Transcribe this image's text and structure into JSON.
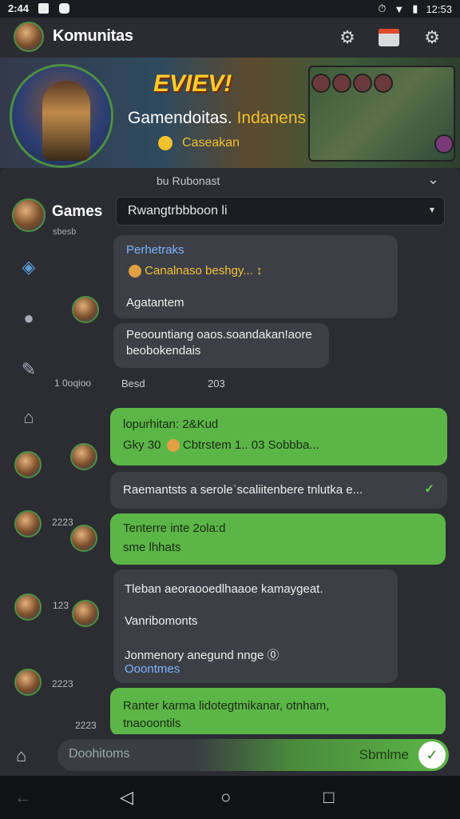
{
  "status_bar": {
    "time": "2:44",
    "battery": "12:53"
  },
  "header": {
    "title": "Komunitas"
  },
  "banner": {
    "logo_text": "EVIEV!",
    "title_white": "Gamendoitas.",
    "title_yellow": "Indanens",
    "subtitle": "Caseakan"
  },
  "panel": {
    "header_text": "bu Rubonast",
    "group_label": "Games",
    "group_sub": "sbesb",
    "dropdown_value": "Rwangtrbbboon li"
  },
  "messages": [
    {
      "style": "gray",
      "lines": [
        "Perhetraks",
        "Canalnaso beshgy... ↕",
        "Agatantem"
      ]
    },
    {
      "style": "gray",
      "lines": [
        "Peoountiang oaos.soandakan!aore",
        "beobokendais"
      ]
    },
    {
      "style": "meta",
      "lines": [
        "Besd",
        "203"
      ]
    },
    {
      "style": "green",
      "lines": [
        "lopurhitan: 2&Kud",
        "Gky 30",
        "Cbtrstem",
        "1..",
        "03 Sobbba..."
      ]
    },
    {
      "style": "gray",
      "lines": [
        "Raemantsts a seroleˈscaliitenbere tnlutka   e..."
      ]
    },
    {
      "style": "green",
      "lines": [
        "Tenterre inte  2ola:d",
        "sme lhhats"
      ]
    },
    {
      "style": "gray",
      "lines": [
        "Tleban aeoraooedlhaaoe kamaygeat.",
        "Vanribomonts",
        "Jonmenory anegund nnge ⓪",
        "Ooontmes"
      ]
    },
    {
      "style": "green",
      "lines": [
        "Ranter  karma lidotegtmikanar, otnham,",
        "tnaooontils"
      ]
    }
  ],
  "timestamps": [
    "1 0oqioo",
    "2223",
    "123",
    "2223",
    "2223"
  ],
  "composer": {
    "placeholder": "Doohitoms",
    "send_label": "Sbmlme"
  }
}
